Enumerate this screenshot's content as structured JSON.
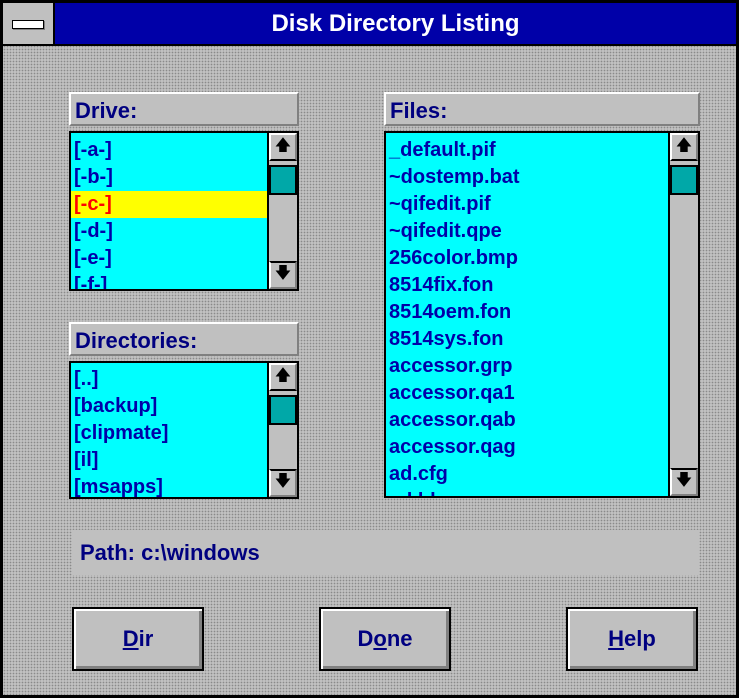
{
  "window": {
    "title": "Disk Directory Listing"
  },
  "drive": {
    "label": "Drive:",
    "items": [
      "[-a-]",
      "[-b-]",
      "[-c-]",
      "[-d-]",
      "[-e-]",
      "[-f-]"
    ],
    "selected_index": 2
  },
  "directories": {
    "label": "Directories:",
    "items": [
      "[..]",
      "[backup]",
      "[clipmate]",
      "[il]",
      "[msapps]"
    ]
  },
  "files": {
    "label": "Files:",
    "items": [
      "_default.pif",
      "~dostemp.bat",
      "~qifedit.pif",
      "~qifedit.qpe",
      "256color.bmp",
      "8514fix.fon",
      "8514oem.fon",
      "8514sys.fon",
      "accessor.grp",
      "accessor.qa1",
      "accessor.qab",
      "accessor.qag",
      "ad.cfg",
      "ad.hlp"
    ]
  },
  "path": {
    "text": "Path:  c:\\windows"
  },
  "buttons": {
    "dir": {
      "pre": "",
      "accel": "D",
      "post": "ir"
    },
    "done": {
      "pre": "D",
      "accel": "o",
      "post": "ne"
    },
    "help": {
      "pre": "",
      "accel": "H",
      "post": "elp"
    }
  },
  "colors": {
    "titlebar": "#0000a8",
    "list_bg": "#00ffff",
    "list_text": "#0000a8",
    "selection_bg": "#ffff00",
    "selection_text": "#ff0000",
    "thumb": "#00a8a8"
  },
  "icons": {
    "system_menu": "system-menu-icon",
    "scroll_up": "arrow-up-icon",
    "scroll_down": "arrow-down-icon"
  }
}
